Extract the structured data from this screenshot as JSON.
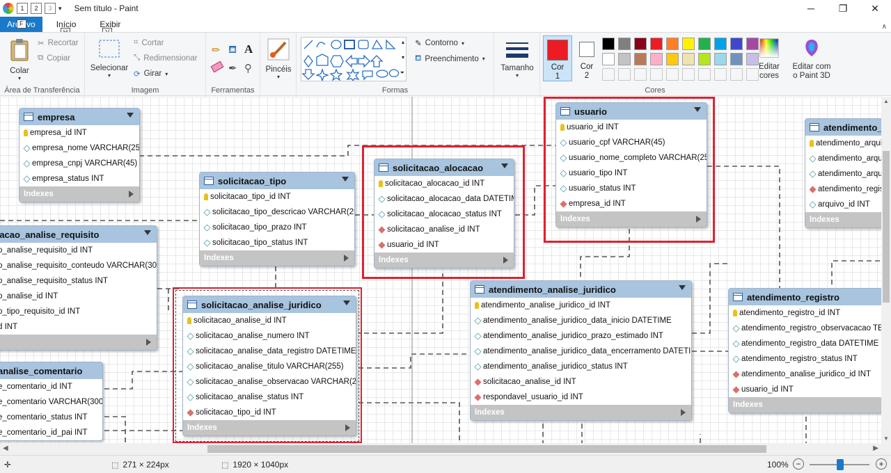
{
  "window": {
    "title": "Sem título - Paint"
  },
  "quick_access": {
    "keytips": [
      "1",
      "2",
      "3"
    ]
  },
  "tabs": [
    {
      "label": "Arquivo",
      "keytip": "F"
    },
    {
      "label": "Início",
      "keytip": "H"
    },
    {
      "label": "Exibir",
      "keytip": "V"
    }
  ],
  "ribbon": {
    "clipboard": {
      "group_label": "Área de Transferência",
      "paste": "Colar",
      "cut": "Recortar",
      "copy": "Copiar"
    },
    "image": {
      "group_label": "Imagem",
      "select": "Selecionar",
      "crop": "Cortar",
      "resize": "Redimensionar",
      "rotate": "Girar"
    },
    "tools": {
      "group_label": "Ferramentas"
    },
    "brushes": {
      "label": "Pincéis"
    },
    "shapes": {
      "group_label": "Formas",
      "outline": "Contorno",
      "fill": "Preenchimento"
    },
    "size": {
      "label": "Tamanho"
    },
    "colors": {
      "group_label": "Cores",
      "color1": "Cor 1",
      "color2": "Cor 2",
      "edit": "Editar cores",
      "paint3d": "Editar com o Paint 3D",
      "color1_value": "#ed1c24",
      "color2_value": "#ffffff",
      "palette_row1": [
        "#000000",
        "#7f7f7f",
        "#880015",
        "#ed1c24",
        "#ff7f27",
        "#fff200",
        "#22b14c",
        "#00a2e8",
        "#3f48cc",
        "#a349a4"
      ],
      "palette_row2": [
        "#ffffff",
        "#c3c3c3",
        "#b97a57",
        "#ffaec9",
        "#ffc90e",
        "#efe4b0",
        "#b5e61d",
        "#99d9ea",
        "#7092be",
        "#c8bfe7"
      ]
    }
  },
  "diagram": {
    "indexes_label": "Indexes",
    "tables": [
      {
        "name": "empresa",
        "rows": [
          {
            "kind": "key",
            "text": "empresa_id INT"
          },
          {
            "kind": "attr",
            "text": "empresa_nome VARCHAR(255)"
          },
          {
            "kind": "attr",
            "text": "empresa_cnpj VARCHAR(45)"
          },
          {
            "kind": "attr",
            "text": "empresa_status INT"
          }
        ]
      },
      {
        "name": "solicitacao_tipo",
        "rows": [
          {
            "kind": "key",
            "text": "solicitacao_tipo_id INT"
          },
          {
            "kind": "attr",
            "text": "solicitacao_tipo_descricao VARCHAR(255)"
          },
          {
            "kind": "attr",
            "text": "solicitacao_tipo_prazo INT"
          },
          {
            "kind": "attr",
            "text": "solicitacao_tipo_status INT"
          }
        ]
      },
      {
        "name": "solicitacao_alocacao",
        "rows": [
          {
            "kind": "key",
            "text": "solicitacao_alocacao_id INT"
          },
          {
            "kind": "attr",
            "text": "solicitacao_alocacao_data DATETIME"
          },
          {
            "kind": "attr",
            "text": "solicitacao_alocacao_status INT"
          },
          {
            "kind": "fk",
            "text": "solicitacao_analise_id INT"
          },
          {
            "kind": "fk",
            "text": "usuario_id INT"
          }
        ]
      },
      {
        "name": "usuario",
        "rows": [
          {
            "kind": "key",
            "text": "usuario_id INT"
          },
          {
            "kind": "attr",
            "text": "usuario_cpf VARCHAR(45)"
          },
          {
            "kind": "attr",
            "text": "usuario_nome_completo VARCHAR(255)"
          },
          {
            "kind": "attr",
            "text": "usuario_tipo INT"
          },
          {
            "kind": "attr",
            "text": "usuario_status INT"
          },
          {
            "kind": "fk",
            "text": "empresa_id INT"
          }
        ]
      },
      {
        "name": "atendimento_",
        "rows": [
          {
            "kind": "key",
            "text": "atendimento_arqui"
          },
          {
            "kind": "attr",
            "text": "atendimento_arqui"
          },
          {
            "kind": "attr",
            "text": "atendimento_arqui"
          },
          {
            "kind": "fk",
            "text": "atendimento_regist"
          },
          {
            "kind": "attr",
            "text": "arquivo_id INT"
          }
        ]
      },
      {
        "name": "tacao_analise_requisito",
        "rows": [
          {
            "kind": "none",
            "text": "o_analise_requisito_id INT"
          },
          {
            "kind": "none",
            "text": "o_analise_requisito_conteudo VARCHAR(300)"
          },
          {
            "kind": "none",
            "text": "o_analise_requisito_status INT"
          },
          {
            "kind": "none",
            "text": "o_analise_id INT"
          },
          {
            "kind": "none",
            "text": "o_tipo_requisito_id INT"
          },
          {
            "kind": "none",
            "text": "d INT"
          }
        ]
      },
      {
        "name": "solicitacao_analise_juridico",
        "rows": [
          {
            "kind": "key",
            "text": "solicitacao_analise_id INT"
          },
          {
            "kind": "attr",
            "text": "solicitacao_analise_numero INT"
          },
          {
            "kind": "attr",
            "text": "solicitacao_analise_data_registro DATETIME"
          },
          {
            "kind": "attr",
            "text": "solicitacao_analise_titulo VARCHAR(255)"
          },
          {
            "kind": "attr",
            "text": "solicitacao_analise_observacao VARCHAR(255)"
          },
          {
            "kind": "attr",
            "text": "solicitacao_analise_status INT"
          },
          {
            "kind": "fk",
            "text": "solicitacao_tipo_id INT"
          }
        ]
      },
      {
        "name": "atendimento_analise_juridico",
        "rows": [
          {
            "kind": "key",
            "text": "atendimento_analise_juridico_id INT"
          },
          {
            "kind": "attr",
            "text": "atendimento_analise_juridico_data_inicio DATETIME"
          },
          {
            "kind": "attr",
            "text": "atendimento_analise_juridico_prazo_estimado INT"
          },
          {
            "kind": "attr",
            "text": "atendimento_analise_juridico_data_encerramento DATETIME"
          },
          {
            "kind": "attr",
            "text": "atendimento_analise_juridico_status INT"
          },
          {
            "kind": "fk",
            "text": "solicitacao_analise_id INT"
          },
          {
            "kind": "fk",
            "text": "respondavel_usuario_id INT"
          }
        ]
      },
      {
        "name": "atendimento_registro",
        "rows": [
          {
            "kind": "key",
            "text": "atendimento_registro_id INT"
          },
          {
            "kind": "attr",
            "text": "atendimento_registro_observacacao TEXT"
          },
          {
            "kind": "attr",
            "text": "atendimento_registro_data DATETIME"
          },
          {
            "kind": "attr",
            "text": "atendimento_registro_status INT"
          },
          {
            "kind": "fk",
            "text": "atendimento_analise_juridico_id INT"
          },
          {
            "kind": "fk",
            "text": "usuario_id INT"
          }
        ]
      },
      {
        "name": "analise_comentario",
        "rows": [
          {
            "kind": "none",
            "text": "e_comentario_id INT"
          },
          {
            "kind": "none",
            "text": "e_comentario VARCHAR(300)"
          },
          {
            "kind": "none",
            "text": "e_comentario_status INT"
          },
          {
            "kind": "none",
            "text": "e_comentario_id_pai INT"
          }
        ]
      }
    ]
  },
  "statusbar": {
    "selection_size": "271 × 224px",
    "image_size": "1920 × 1040px",
    "zoom": "100%",
    "zoom_out": "−",
    "zoom_in": "+"
  }
}
